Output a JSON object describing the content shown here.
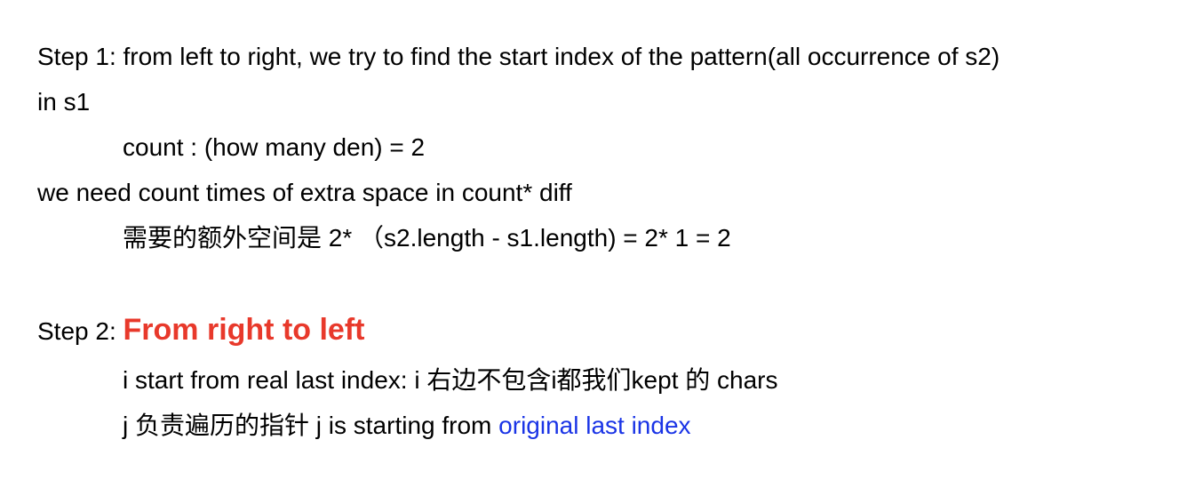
{
  "step1": {
    "line1": "Step 1: from left to right, we try to find the start index of the pattern(all occurrence of s2)",
    "line2": "in s1",
    "count_line": "count : (how many den)  =  2",
    "extra_line": "we need count times of extra space in count* diff",
    "chinese_line": "需要的额外空间是 2*  （s2.length - s1.length) = 2* 1 = 2"
  },
  "step2": {
    "prefix": "Step 2: ",
    "heading": "From right to left",
    "i_line": "i start from real last index: i 右边不包含i都我们kept 的 chars",
    "j_line_prefix": "j 负责遍历的指针  j is starting from ",
    "j_line_highlight": "original last index"
  },
  "colors": {
    "heading_red": "#e8392b",
    "link_blue": "#1a34e6",
    "text": "#000000",
    "background": "#ffffff"
  }
}
